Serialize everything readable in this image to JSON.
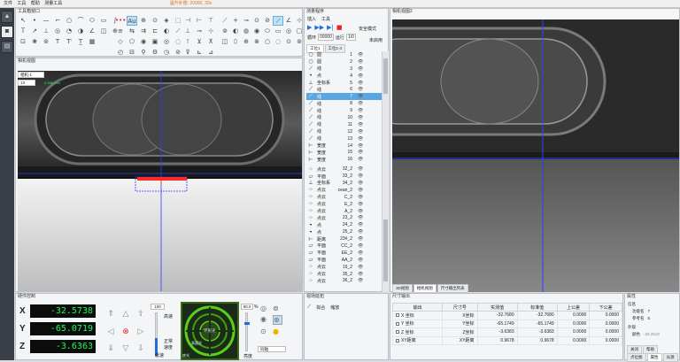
{
  "menu": {
    "items": [
      "文件",
      "工具",
      "帮助",
      "测量工具"
    ],
    "warning": "温升补偿: 20000, 20s"
  },
  "left_toolbar": [
    {
      "icon": "logo-icon",
      "glyph": "▲"
    },
    {
      "icon": "camera-icon",
      "glyph": "◙"
    },
    {
      "icon": "layers-icon",
      "glyph": "▤"
    }
  ],
  "toolbox": {
    "title": "工具箱窗口",
    "group1": [
      "↖",
      "•",
      "—",
      "⌐",
      "○",
      "⌒",
      "⬭",
      "▭",
      "∫",
      "Ｔ",
      "↗",
      "⊥",
      "◎",
      "◔",
      "◑",
      "∠",
      "◫",
      "⊕",
      "⊡",
      "❀",
      "⊚",
      "T",
      "Tⁱ",
      "T̲",
      "▦"
    ],
    "group2": [
      "•••",
      "Au",
      "⊕",
      "⊙",
      "◈",
      "⬚",
      "≡",
      "⇆",
      "⇉",
      "⊏",
      "◐",
      "⟋",
      "◇",
      "⬠",
      "◉",
      "▣",
      "◎",
      "◌",
      "◴",
      "⊟",
      "⚲",
      "⚙",
      "◷",
      "⊘",
      "⊞"
    ],
    "group3": [
      "⊣",
      "⊢",
      "⊤",
      "⊥",
      "⊸",
      "⊹",
      "⊺",
      "⊻",
      "⊼",
      "⊽",
      "⊾",
      "⊿",
      "⟂"
    ],
    "group4": [
      "⟋",
      "+",
      "⊸",
      "⊙",
      "⊘",
      "⟋",
      "∠",
      "⊹",
      "⊚",
      "◐",
      "◍",
      "◉",
      "⬭",
      "▭",
      "◎",
      "▢",
      "◫",
      "⬯",
      "⊕",
      "⊗",
      "○",
      "◌",
      "⊙",
      "⊚"
    ]
  },
  "view": {
    "title": "相机视图",
    "camera_select": "相机-1",
    "zoom_select": "1X",
    "scale_label": "0.356 mm"
  },
  "steps": {
    "title": "测量程序",
    "tabs": [
      "插入",
      "工具"
    ],
    "loop_label": "循环",
    "loop_value": "00000",
    "run_label": "运行",
    "run_value": "1/0",
    "safe_mode": "安全模式",
    "unassigned": "未启用",
    "sub_tabs": [
      "工位1",
      "工位1-4"
    ],
    "items": [
      {
        "icon": "○",
        "name": "圆",
        "id": "1"
      },
      {
        "icon": "○",
        "name": "圆",
        "id": "2"
      },
      {
        "icon": "⟋",
        "name": "线",
        "id": "3"
      },
      {
        "icon": "•",
        "name": "点",
        "id": "4"
      },
      {
        "icon": "⊥",
        "name": "坐标系",
        "id": "5"
      },
      {
        "icon": "⟋",
        "name": "线",
        "id": "6"
      },
      {
        "icon": "⟋",
        "name": "线",
        "id": "7"
      },
      {
        "icon": "⟋",
        "name": "线",
        "id": "8"
      },
      {
        "icon": "⟋",
        "name": "线",
        "id": "9"
      },
      {
        "icon": "⟋",
        "name": "线",
        "id": "10"
      },
      {
        "icon": "⟋",
        "name": "线",
        "id": "11"
      },
      {
        "icon": "⟋",
        "name": "线",
        "id": "12"
      },
      {
        "icon": "⟋",
        "name": "线",
        "id": "13"
      },
      {
        "icon": "⊢",
        "name": "宽度",
        "id": "14"
      },
      {
        "icon": "⊢",
        "name": "宽度",
        "id": "15"
      },
      {
        "icon": "⊢",
        "name": "宽度",
        "id": "16"
      }
    ],
    "items2": [
      {
        "icon": "⁘",
        "name": "点云",
        "id": "32_2"
      },
      {
        "icon": "▱",
        "name": "平面",
        "id": "33_2"
      },
      {
        "icon": "⊥",
        "name": "坐标系",
        "id": "34_2"
      },
      {
        "icon": "⁘",
        "name": "点云",
        "id": "cean_2"
      },
      {
        "icon": "⁘",
        "name": "点云",
        "id": "C_2"
      },
      {
        "icon": "⁘",
        "name": "点云",
        "id": "E_2"
      },
      {
        "icon": "⁘",
        "name": "点云",
        "id": "A_2"
      },
      {
        "icon": "⁘",
        "name": "点云",
        "id": "23_2"
      },
      {
        "icon": "•",
        "name": "点",
        "id": "24_2"
      },
      {
        "icon": "•",
        "name": "点",
        "id": "25_2"
      },
      {
        "icon": "⊢",
        "name": "距离",
        "id": "23#_2"
      },
      {
        "icon": "▱",
        "name": "平面",
        "id": "CC_2"
      },
      {
        "icon": "▱",
        "name": "平面",
        "id": "EE_2"
      },
      {
        "icon": "▱",
        "name": "平面",
        "id": "AA_2"
      },
      {
        "icon": "⁘",
        "name": "点云",
        "id": "19_2"
      },
      {
        "icon": "⁘",
        "name": "点云",
        "id": "35_2"
      },
      {
        "icon": "⁘",
        "name": "点云",
        "id": "36_2"
      }
    ],
    "eye_icon": "👁"
  },
  "right_view": {
    "title": "相机视图2",
    "tabs": [
      "3D视图",
      "相机视图",
      "尺寸输出列表"
    ]
  },
  "hardware": {
    "title": "硬件控制",
    "x_label": "X",
    "x_value": "-32.5738",
    "y_label": "Y",
    "y_value": "-65.0719",
    "z_label": "Z",
    "z_value": "-3.6363",
    "speed_value": "100",
    "speed_high": "高速",
    "speed_mid": "正常速度",
    "speed_low": "低速",
    "zoom_value": "80.0",
    "zoom_unit": "%",
    "focus_label": "亮度",
    "light_select": "同轴",
    "ring_title": "环形光",
    "ring_low": "底光",
    "ring_mid": "表面光"
  },
  "ext": {
    "title": "视场延拓",
    "labels": [
      "拟合",
      "缩放"
    ]
  },
  "measure": {
    "title": "尺寸输出",
    "columns": [
      "输出",
      "尺寸号",
      "实测值",
      "标准值",
      "上公差",
      "下公差"
    ],
    "rows": [
      [
        "X 坐标",
        "X坐标",
        "-32.7680",
        "-32.7680",
        "0.0000",
        "0.0000"
      ],
      [
        "Y 坐标",
        "Y坐标",
        "-65.1749",
        "-65.1749",
        "0.0000",
        "0.0000"
      ],
      [
        "Z 坐标",
        "Z坐标",
        "-3.6383",
        "-3.6383",
        "0.0000",
        "0.0000"
      ],
      [
        "XY距离",
        "XY距离",
        "0.9678",
        "0.9678",
        "0.0000",
        "0.0000"
      ]
    ]
  },
  "props": {
    "title": "属性",
    "group1": "信息",
    "row1_label": "功能名",
    "row1_value": "7",
    "row2_label": "参考名",
    "row2_value": "5",
    "group2": "外观",
    "row3_label": "颜色",
    "row3_value": "-33.2519",
    "tabs": [
      "关闭",
      "帮助"
    ],
    "bottom_tabs": [
      "点位图",
      "属性",
      "光源"
    ]
  },
  "colors": {
    "accent": "#1e6fd9",
    "lcd_bg": "#0c0c0c",
    "lcd_fg": "#19ff5a",
    "crosshair": "#2d3dff",
    "selection": "#ff2a2a"
  }
}
